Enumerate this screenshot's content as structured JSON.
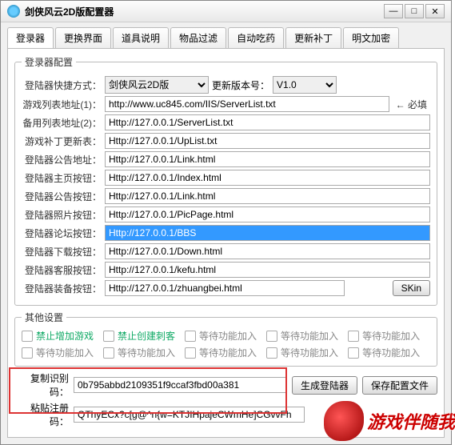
{
  "title": "剑侠风云2D版配置器",
  "tabs": [
    "登录器",
    "更换界面",
    "道具说明",
    "物品过滤",
    "自动吃药",
    "更新补丁",
    "明文加密"
  ],
  "fieldset1": "登录器配置",
  "labels": {
    "shortcut": "登陆器快捷方式：",
    "shortcut_val": "剑侠风云2D版",
    "version_lbl": "更新版本号：",
    "version_val": "V1.0",
    "serverlist": "游戏列表地址(1)：",
    "serverlist_val": "http://www.uc845.com/IIS/ServerList.txt",
    "required": "← 必填",
    "backup": "备用列表地址(2)：",
    "backup_val": "Http://127.0.0.1/ServerList.txt",
    "uplist": "游戏补丁更新表：",
    "uplist_val": "Http://127.0.0.1/UpList.txt",
    "link": "登陆器公告地址：",
    "link_val": "Http://127.0.0.1/Link.html",
    "index": "登陆器主页按钮：",
    "index_val": "Http://127.0.0.1/Index.html",
    "notice": "登陆器公告按钮：",
    "notice_val": "Http://127.0.0.1/Link.html",
    "pic": "登陆器照片按钮：",
    "pic_val": "Http://127.0.0.1/PicPage.html",
    "bbs": "登陆器论坛按钮：",
    "bbs_val": "Http://127.0.0.1/BBS",
    "down": "登陆器下载按钮：",
    "down_val": "Http://127.0.0.1/Down.html",
    "kefu": "登陆器客服按钮：",
    "kefu_val": "Http://127.0.0.1/kefu.html",
    "equip": "登陆器装备按钮：",
    "equip_val": "Http://127.0.0.1/zhuangbei.html",
    "skin": "SKin"
  },
  "fieldset2": "其他设置",
  "checks": [
    "禁止增加游戏",
    "禁止创建刺客",
    "等待功能加入",
    "等待功能加入",
    "等待功能加入",
    "等待功能加入",
    "等待功能加入",
    "等待功能加入",
    "等待功能加入",
    "等待功能加入"
  ],
  "copy_lbl": "复制识别码：",
  "copy_val": "0b795abbd2109351f9ccaf3fbd00a381",
  "reg_lbl": "粘贴注册码：",
  "reg_val": "QThyECx?c[g@^n{w=KTJIHpajeCWmHe]CGvvFh",
  "btn_gen": "生成登陆器",
  "btn_save": "保存配置文件",
  "watermark": "游戏伴随我"
}
